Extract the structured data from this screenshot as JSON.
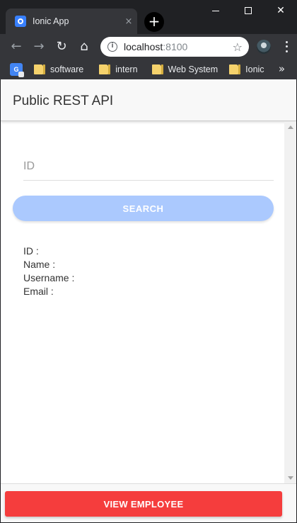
{
  "browser": {
    "tab_title": "Ionic App",
    "tab_close": "×",
    "new_tab": "+",
    "url_host": "localhost",
    "url_port": ":8100",
    "back_icon": "←",
    "forward_icon": "→",
    "reload_icon": "↻",
    "home_icon": "⌂",
    "star_icon": "☆",
    "info_icon": "i",
    "window_close": "✕",
    "bookmarks": [
      {
        "label": "software"
      },
      {
        "label": "intern"
      },
      {
        "label": "Web System"
      },
      {
        "label": "Ionic"
      }
    ],
    "bookmarks_more": "»"
  },
  "page": {
    "title": "Public REST API",
    "id_placeholder": "ID",
    "search_label": "SEARCH",
    "result": {
      "id_label": "ID :",
      "name_label": "Name :",
      "username_label": "Username :",
      "email_label": "Email :"
    },
    "view_employee_label": "VIEW EMPLOYEE"
  },
  "colors": {
    "search_button": "#abc9fe",
    "view_button": "#f53d3d",
    "header_bg": "#f8f8f8",
    "browser_dark": "#202124"
  }
}
